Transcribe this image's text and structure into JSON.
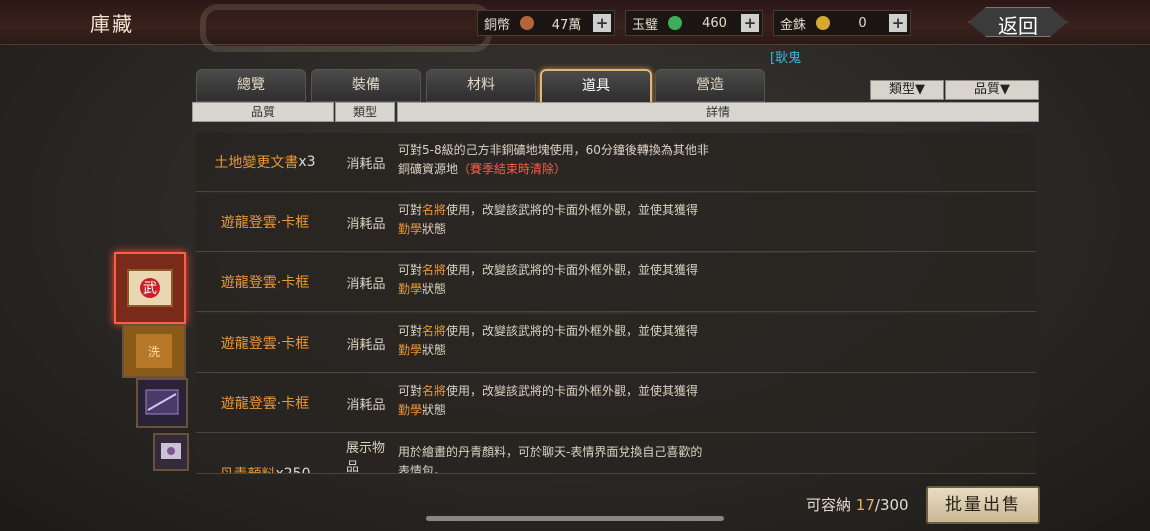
{
  "header": {
    "title": "庫藏",
    "back_label": "返回",
    "currencies": [
      {
        "label": "銅幣",
        "value": "47萬",
        "coin_color": "#b5653a"
      },
      {
        "label": "玉璧",
        "value": "460",
        "coin_color": "#3fae5a"
      },
      {
        "label": "金銖",
        "value": "0",
        "coin_color": "#d9a82e"
      }
    ],
    "plus": "+"
  },
  "player_name": "[耿鬼",
  "tabs": [
    {
      "label": "總覽"
    },
    {
      "label": "裝備"
    },
    {
      "label": "材料"
    },
    {
      "label": "道具",
      "active": true
    },
    {
      "label": "營造"
    }
  ],
  "filters": {
    "type": "類型▼",
    "quality": "品質▼"
  },
  "columns": {
    "quality": "品質",
    "type": "類型",
    "detail": "詳情"
  },
  "items": [
    {
      "name": "土地變更文書",
      "qty": "x3",
      "type": "消耗品",
      "detail_a": "可對5-8級的己方非銅礦地塊使用，60分鐘後轉換為其他非",
      "detail_b": "銅礦資源地",
      "detail_red": "（賽季結束時清除）"
    },
    {
      "name": "遊龍登雲·卡框",
      "type": "消耗品",
      "detail_a": "可對",
      "detail_hl1": "名將",
      "detail_b": "使用，改變該武將的卡面外框外觀，並使其獲得",
      "detail_hl2": "勤學",
      "detail_c": "狀態"
    },
    {
      "name": "遊龍登雲·卡框",
      "type": "消耗品",
      "detail_a": "可對",
      "detail_hl1": "名將",
      "detail_b": "使用，改變該武將的卡面外框外觀，並使其獲得",
      "detail_hl2": "勤學",
      "detail_c": "狀態"
    },
    {
      "name": "遊龍登雲·卡框",
      "type": "消耗品",
      "detail_a": "可對",
      "detail_hl1": "名將",
      "detail_b": "使用，改變該武將的卡面外框外觀，並使其獲得",
      "detail_hl2": "勤學",
      "detail_c": "狀態"
    },
    {
      "name": "遊龍登雲·卡框",
      "type": "消耗品",
      "detail_a": "可對",
      "detail_hl1": "名將",
      "detail_b": "使用，改變該武將的卡面外框外觀，並使其獲得",
      "detail_hl2": "勤學",
      "detail_c": "狀態"
    },
    {
      "name": "丹青顏料",
      "qty": "x250",
      "type": "展示物品",
      "detail_a": "用於繪畫的丹青顏料，可於聊天-表情界面兌換自己喜歡的",
      "detail_b": "表情包。"
    }
  ],
  "thumb_letter": "武",
  "thumb_letter_2": "洗",
  "footer": {
    "capacity_label": "可容納",
    "capacity_current": "17",
    "capacity_max": "/300",
    "sell_label": "批量出售"
  }
}
